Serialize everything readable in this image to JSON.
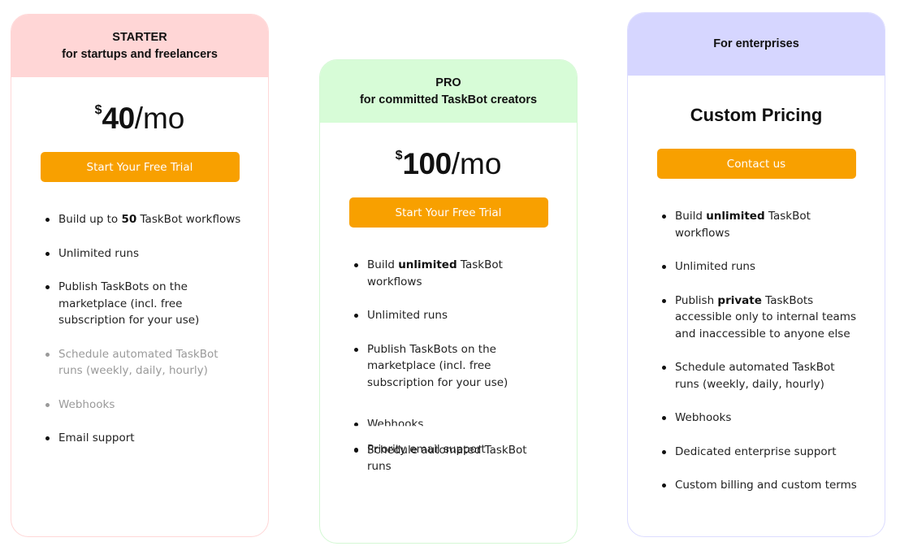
{
  "colors": {
    "accent_button": "#f8a000",
    "starter_header": "#ffd6d6",
    "pro_header": "#d7fcd7",
    "enterprise_header": "#d6d6ff",
    "muted_text": "#9a9a9a"
  },
  "plans": [
    {
      "id": "starter",
      "title": "STARTER",
      "subtitle": "for startups and freelancers",
      "currency": "$",
      "amount": "40",
      "period": "/mo",
      "button": "Start Your Free Trial",
      "features": [
        {
          "pre": "Build up to ",
          "bold": "50",
          "post": " TaskBot workflows",
          "muted": false
        },
        {
          "pre": "Unlimited runs",
          "bold": "",
          "post": "",
          "muted": false
        },
        {
          "pre": "Publish TaskBots on the marketplace (incl. free subscription for your use)",
          "bold": "",
          "post": "",
          "muted": false
        },
        {
          "pre": "Schedule automated TaskBot runs (weekly, daily, hourly)",
          "bold": "",
          "post": "",
          "muted": true
        },
        {
          "pre": "Webhooks",
          "bold": "",
          "post": "",
          "muted": true
        },
        {
          "pre": "Email support",
          "bold": "",
          "post": "",
          "muted": false
        }
      ]
    },
    {
      "id": "pro",
      "title": "PRO",
      "subtitle": "for committed TaskBot creators",
      "currency": "$",
      "amount": "100",
      "period": "/mo",
      "button": "Start Your Free Trial",
      "features": [
        {
          "pre": "Build ",
          "bold": "unlimited",
          "post": " TaskBot workflows",
          "muted": false
        },
        {
          "pre": "Unlimited runs",
          "bold": "",
          "post": "",
          "muted": false
        },
        {
          "pre": "Publish TaskBots on the marketplace (incl. free subscription for your use)",
          "bold": "",
          "post": "",
          "muted": false
        },
        {
          "pre": "Schedule automated TaskBot runs",
          "bold": "",
          "post": "",
          "muted": false
        },
        {
          "pre": "Webhooks",
          "bold": "",
          "post": "",
          "muted": false
        },
        {
          "pre": "Priority email support",
          "bold": "",
          "post": "",
          "muted": false
        }
      ]
    },
    {
      "id": "enterprise",
      "title": "For enterprises",
      "price_label": "Custom Pricing",
      "button": "Contact us",
      "features": [
        {
          "pre": "Build ",
          "bold": "unlimited",
          "post": " TaskBot workflows",
          "muted": false
        },
        {
          "pre": "Unlimited runs",
          "bold": "",
          "post": "",
          "muted": false
        },
        {
          "pre": "Publish ",
          "bold": "private",
          "post": " TaskBots accessible only to internal teams and inaccessible to anyone else",
          "muted": false
        },
        {
          "pre": "Schedule automated TaskBot runs (weekly, daily, hourly)",
          "bold": "",
          "post": "",
          "muted": false
        },
        {
          "pre": "Webhooks",
          "bold": "",
          "post": "",
          "muted": false
        },
        {
          "pre": "Dedicated enterprise support",
          "bold": "",
          "post": "",
          "muted": false
        },
        {
          "pre": "Custom billing and custom terms",
          "bold": "",
          "post": "",
          "muted": false
        }
      ]
    }
  ]
}
